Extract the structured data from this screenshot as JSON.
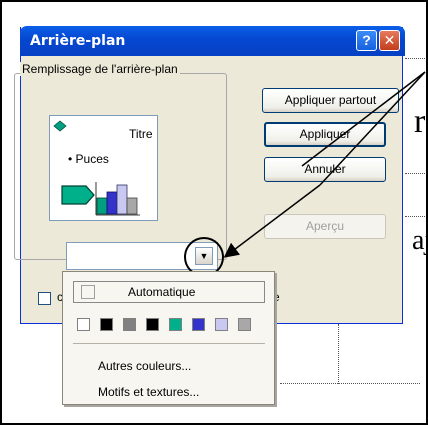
{
  "dialog": {
    "title": "Arrière-plan",
    "help_glyph": "?",
    "close_glyph": "✕",
    "group_label": "Remplissage de l'arrière-plan",
    "preview": {
      "title_text": "Titre",
      "bullet_text": "• Puces"
    },
    "buttons": {
      "apply_all": "Appliquer partout",
      "apply": "Appliquer",
      "cancel": "Annuler",
      "preview": "Aperçu"
    },
    "combo_arrow": "▼",
    "checkbox_partial_left": "c",
    "checkbox_partial_right": "e"
  },
  "dropdown": {
    "automatic_label": "Automatique",
    "swatches": [
      "#FFFFFF",
      "#000000",
      "#808080",
      "#000000",
      "#00B08A",
      "#3333CC",
      "#C8C8F0",
      "#A8A8A8"
    ],
    "more_colors": "Autres couleurs...",
    "fill_effects": "Motifs et textures..."
  },
  "slide_background": {
    "text_r": "r",
    "text_aj": "aj"
  },
  "colors": {
    "titlebar": "#0647D0",
    "dialog_bg": "#ECE9D8"
  }
}
